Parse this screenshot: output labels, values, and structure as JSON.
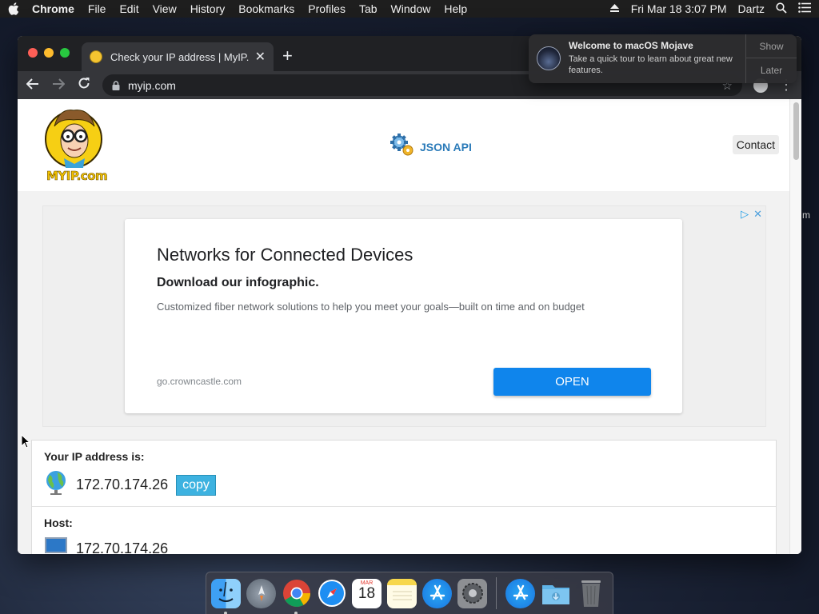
{
  "menubar": {
    "app": "Chrome",
    "items": [
      "File",
      "Edit",
      "View",
      "History",
      "Bookmarks",
      "Profiles",
      "Tab",
      "Window",
      "Help"
    ],
    "clock": "Fri Mar 18  3:07 PM",
    "user": "Dartz"
  },
  "browser": {
    "tab_title": "Check your IP address | MyIP.c",
    "url": "myip.com"
  },
  "site": {
    "logo_text": "MYIP.com",
    "json_api": "JSON API",
    "contact": "Contact"
  },
  "ad": {
    "title": "Networks for Connected Devices",
    "subtitle": "Download our infographic.",
    "body": "Customized fiber network solutions to help you meet your goals—built on time and on budget",
    "url": "go.crowncastle.com",
    "open": "OPEN"
  },
  "ip_info": {
    "ip_label": "Your IP address is:",
    "ip_value": "172.70.174.26",
    "copy": "copy",
    "host_label": "Host:",
    "host_value": "172.70.174.26"
  },
  "notification": {
    "title": "Welcome to macOS Mojave",
    "body": "Take a quick tour to learn about great new features.",
    "show": "Show",
    "later": "Later"
  },
  "dock": {
    "calendar_month": "MAR",
    "calendar_day": "18"
  },
  "colors": {
    "ad_button": "#0f85ec",
    "copy_button": "#3db2e0",
    "json_api": "#2b7bb9"
  }
}
